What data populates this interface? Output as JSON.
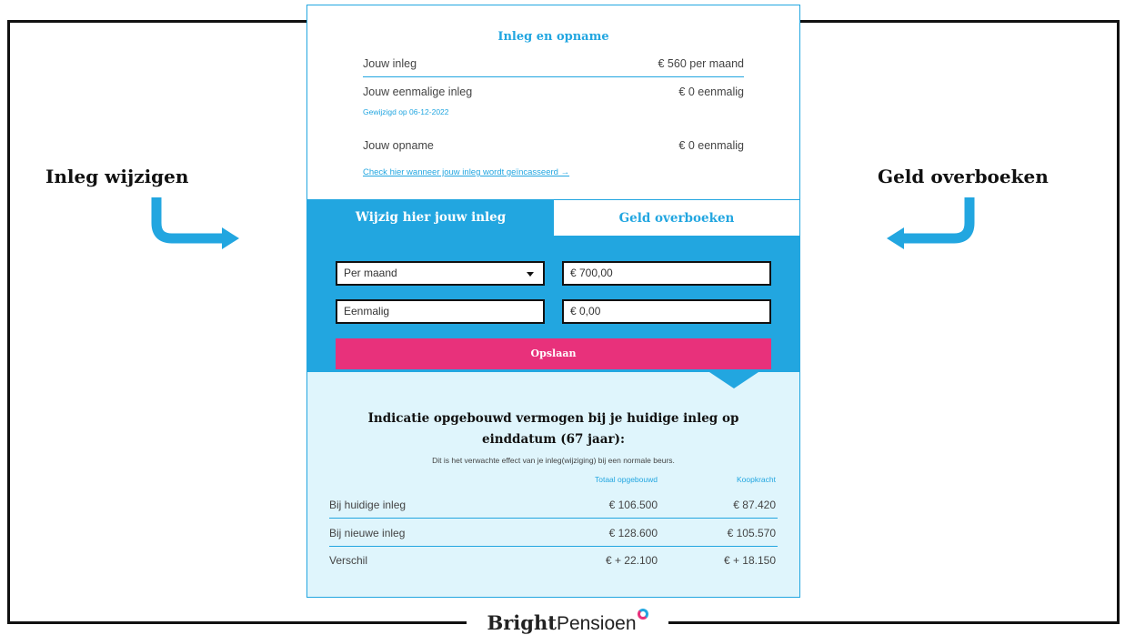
{
  "side_labels": {
    "left": "Inleg wijzigen",
    "right": "Geld overboeken"
  },
  "brand": {
    "bold": "Bright",
    "light": "Pensioen"
  },
  "overview": {
    "title": "Inleg en opname",
    "rows": [
      {
        "label": "Jouw inleg",
        "value": "€ 560 per maand"
      },
      {
        "label": "Jouw eenmalige inleg",
        "value": "€ 0 eenmalig"
      },
      {
        "label": "Jouw opname",
        "value": "€ 0 eenmalig"
      }
    ],
    "changed_note": "Gewijzigd op 06-12-2022",
    "check_link": "Check hier wanneer jouw inleg wordt geïncasseerd →"
  },
  "tabs": {
    "active": "Wijzig hier jouw inleg",
    "inactive": "Geld overboeken"
  },
  "form": {
    "frequency_selected": "Per maand",
    "monthly_amount": "€ 700,00",
    "one_time_label": "Eenmalig",
    "one_time_amount": "€ 0,00",
    "save_label": "Opslaan"
  },
  "indication": {
    "title": "Indicatie opgebouwd vermogen bij je huidige inleg op einddatum (67 jaar):",
    "subtitle": "Dit is het verwachte effect van je inleg(wijziging) bij een normale beurs.",
    "col_total": "Totaal opgebouwd",
    "col_power": "Koopkracht",
    "rows": [
      {
        "label": "Bij huidige inleg",
        "total": "€ 106.500",
        "power": "€ 87.420"
      },
      {
        "label": "Bij nieuwe inleg",
        "total": "€ 128.600",
        "power": "€ 105.570"
      },
      {
        "label": "Verschil",
        "total": "€ + 22.100",
        "power": "€ + 18.150"
      }
    ]
  },
  "colors": {
    "accent": "#22a6e0",
    "pink": "#e8317b",
    "light_bg": "#dff5fc"
  }
}
